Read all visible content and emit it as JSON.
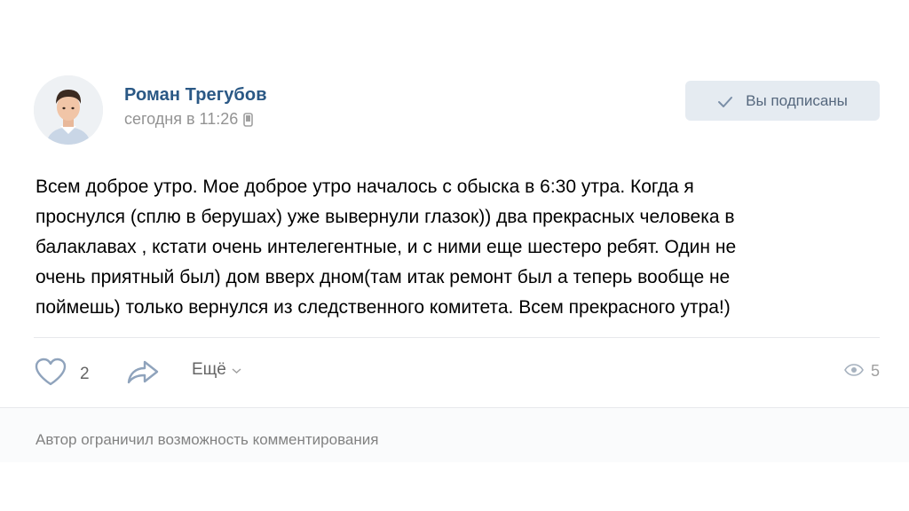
{
  "author": {
    "name": "Роман Трегубов",
    "time": "сегодня в 11:26"
  },
  "subscribe": {
    "label": "Вы подписаны"
  },
  "post": {
    "lines": [
      "Всем доброе утро. Мое доброе утро началось с обыска в 6:30 утра. Когда я",
      "проснулся (сплю в берушах) уже вывернули глазок)) два прекрасных человека в",
      "балаклавах , кстати очень интелегентные, и с ними еще шестеро ребят. Один не",
      "очень приятный был) дом вверх дном(там итак ремонт был а теперь вообще не",
      "поймешь) только вернулся из следственного комитета. Всем прекрасного утра!)"
    ]
  },
  "actions": {
    "likes": "2",
    "more_label": "Ещё",
    "views": "5"
  },
  "comments": {
    "note": "Автор ограничил возможность комментирования"
  },
  "colors": {
    "link": "#2a5885",
    "button_bg": "#e5ebf1",
    "muted": "#939393",
    "icon": "#8fa3bc"
  },
  "icons": [
    "avatar-photo",
    "phone-icon",
    "check-icon",
    "heart-icon",
    "share-arrow-icon",
    "chevron-down-icon",
    "eye-icon"
  ]
}
